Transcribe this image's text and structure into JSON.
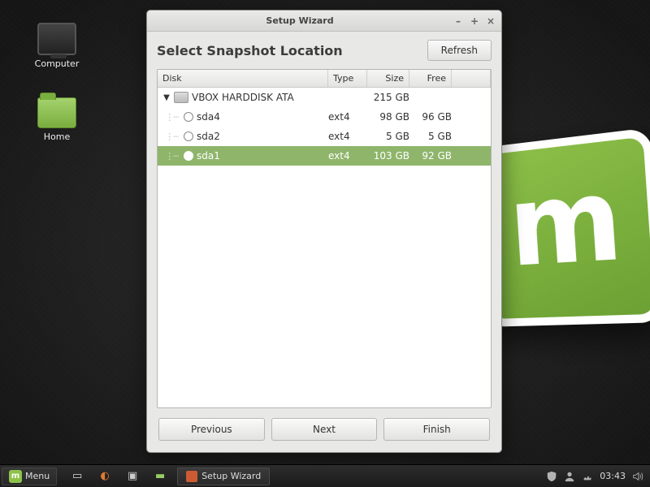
{
  "desktop": {
    "icons": {
      "computer": "Computer",
      "home": "Home"
    }
  },
  "window": {
    "title": "Setup Wizard",
    "heading": "Select Snapshot Location",
    "refresh": "Refresh",
    "columns": {
      "disk": "Disk",
      "type": "Type",
      "size": "Size",
      "free": "Free"
    },
    "disk": {
      "name": "VBOX HARDDISK ATA",
      "size": "215 GB",
      "partitions": [
        {
          "name": "sda4",
          "type": "ext4",
          "size": "98 GB",
          "free": "96 GB",
          "selected": false
        },
        {
          "name": "sda2",
          "type": "ext4",
          "size": "5 GB",
          "free": "5 GB",
          "selected": false
        },
        {
          "name": "sda1",
          "type": "ext4",
          "size": "103 GB",
          "free": "92 GB",
          "selected": true
        }
      ]
    },
    "buttons": {
      "previous": "Previous",
      "next": "Next",
      "finish": "Finish"
    }
  },
  "taskbar": {
    "menu": "Menu",
    "active_task": "Setup Wizard",
    "clock": "03:43"
  }
}
